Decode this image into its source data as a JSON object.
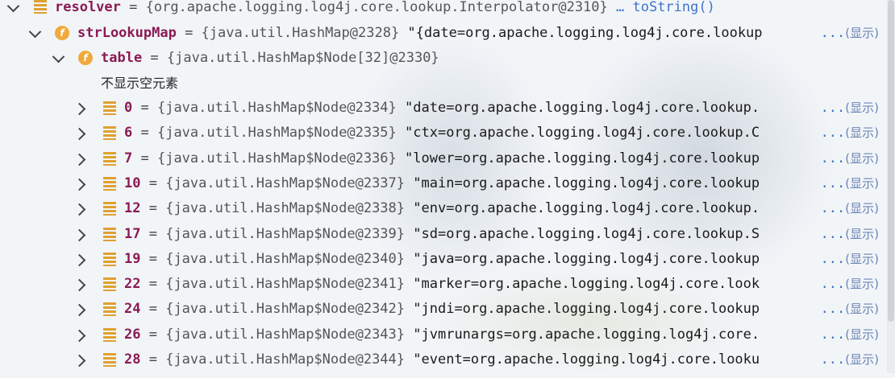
{
  "resolver_row": {
    "name": "resolver",
    "eq": " = ",
    "type": "{org.apache.logging.log4j.core.lookup.Interpolator@2310}",
    "action": "… toString()"
  },
  "strlookup_row": {
    "name": "strLookupMap",
    "eq": " = ",
    "type": "{java.util.HashMap@2328}",
    "value": " \"{date=org.apache.logging.log4j.core.lookup"
  },
  "table_row": {
    "name": "table",
    "eq": " = ",
    "type": "{java.util.HashMap$Node[32]@2330}"
  },
  "hide_empty_label": "不显示空元素",
  "expand": {
    "dots": "...",
    "label": "(显示)"
  },
  "entries": [
    {
      "index": "0",
      "type": "{java.util.HashMap$Node@2334}",
      "value": "\"date=org.apache.logging.log4j.core.lookup."
    },
    {
      "index": "6",
      "type": "{java.util.HashMap$Node@2335}",
      "value": "\"ctx=org.apache.logging.log4j.core.lookup.C"
    },
    {
      "index": "7",
      "type": "{java.util.HashMap$Node@2336}",
      "value": "\"lower=org.apache.logging.log4j.core.lookup"
    },
    {
      "index": "10",
      "type": "{java.util.HashMap$Node@2337}",
      "value": "\"main=org.apache.logging.log4j.core.lookup"
    },
    {
      "index": "12",
      "type": "{java.util.HashMap$Node@2338}",
      "value": "\"env=org.apache.logging.log4j.core.lookup."
    },
    {
      "index": "17",
      "type": "{java.util.HashMap$Node@2339}",
      "value": "\"sd=org.apache.logging.log4j.core.lookup.S"
    },
    {
      "index": "19",
      "type": "{java.util.HashMap$Node@2340}",
      "value": "\"java=org.apache.logging.log4j.core.lookup"
    },
    {
      "index": "22",
      "type": "{java.util.HashMap$Node@2341}",
      "value": "\"marker=org.apache.logging.log4j.core.look"
    },
    {
      "index": "24",
      "type": "{java.util.HashMap$Node@2342}",
      "value": "\"jndi=org.apache.logging.log4j.core.lookup"
    },
    {
      "index": "26",
      "type": "{java.util.HashMap$Node@2343}",
      "value": "\"jvmrunargs=org.apache.logging.log4j.core."
    },
    {
      "index": "28",
      "type": "{java.util.HashMap$Node@2344}",
      "value": "\"event=org.apache.logging.log4j.core.looku"
    }
  ]
}
